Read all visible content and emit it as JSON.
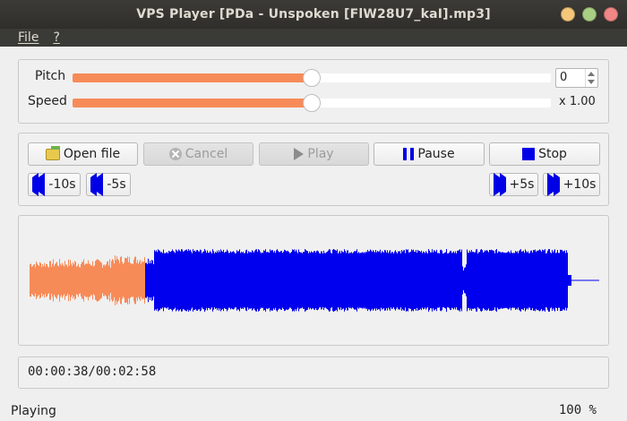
{
  "window": {
    "title": "VPS Player [PDa - Unspoken [FlW28U7_kaI].mp3]"
  },
  "menu": {
    "file": "File",
    "help": "?"
  },
  "pitch": {
    "label": "Pitch",
    "value": "0",
    "slider_fraction": 0.5
  },
  "speed": {
    "label": "Speed",
    "value": "x 1.00",
    "slider_fraction": 0.5
  },
  "buttons": {
    "open": "Open file",
    "cancel": "Cancel",
    "play": "Play",
    "pause": "Pause",
    "stop": "Stop",
    "rew10": "-10s",
    "rew5": "-5s",
    "ff5": "+5s",
    "ff10": "+10s"
  },
  "playback": {
    "time": "00:00:38/00:02:58",
    "progress_fraction": 0.2135
  },
  "status": {
    "text": "Playing",
    "volume": "100 %"
  },
  "colors": {
    "played": "#f78b58",
    "remaining": "#0000ee",
    "slider_fill": "#f78b58"
  }
}
